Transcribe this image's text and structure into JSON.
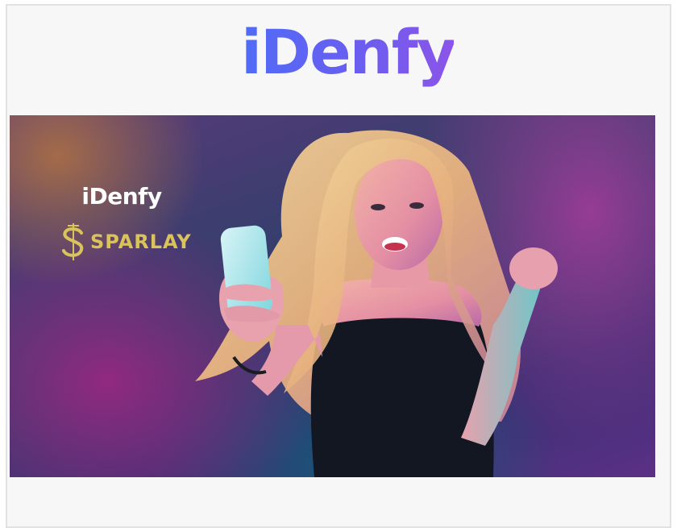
{
  "header": {
    "logo_text": "iDenfy",
    "logo_color": "#5b63f2"
  },
  "hero": {
    "alt": "Woman celebrating while looking at her phone",
    "brand_primary": "iDenfy",
    "brand_partner": "SPARLAY",
    "partner_color": "#d9c35a",
    "symbol": "$",
    "background_colors": [
      "#a86e46",
      "#962882",
      "#2f3f6a",
      "#5b3086"
    ]
  }
}
